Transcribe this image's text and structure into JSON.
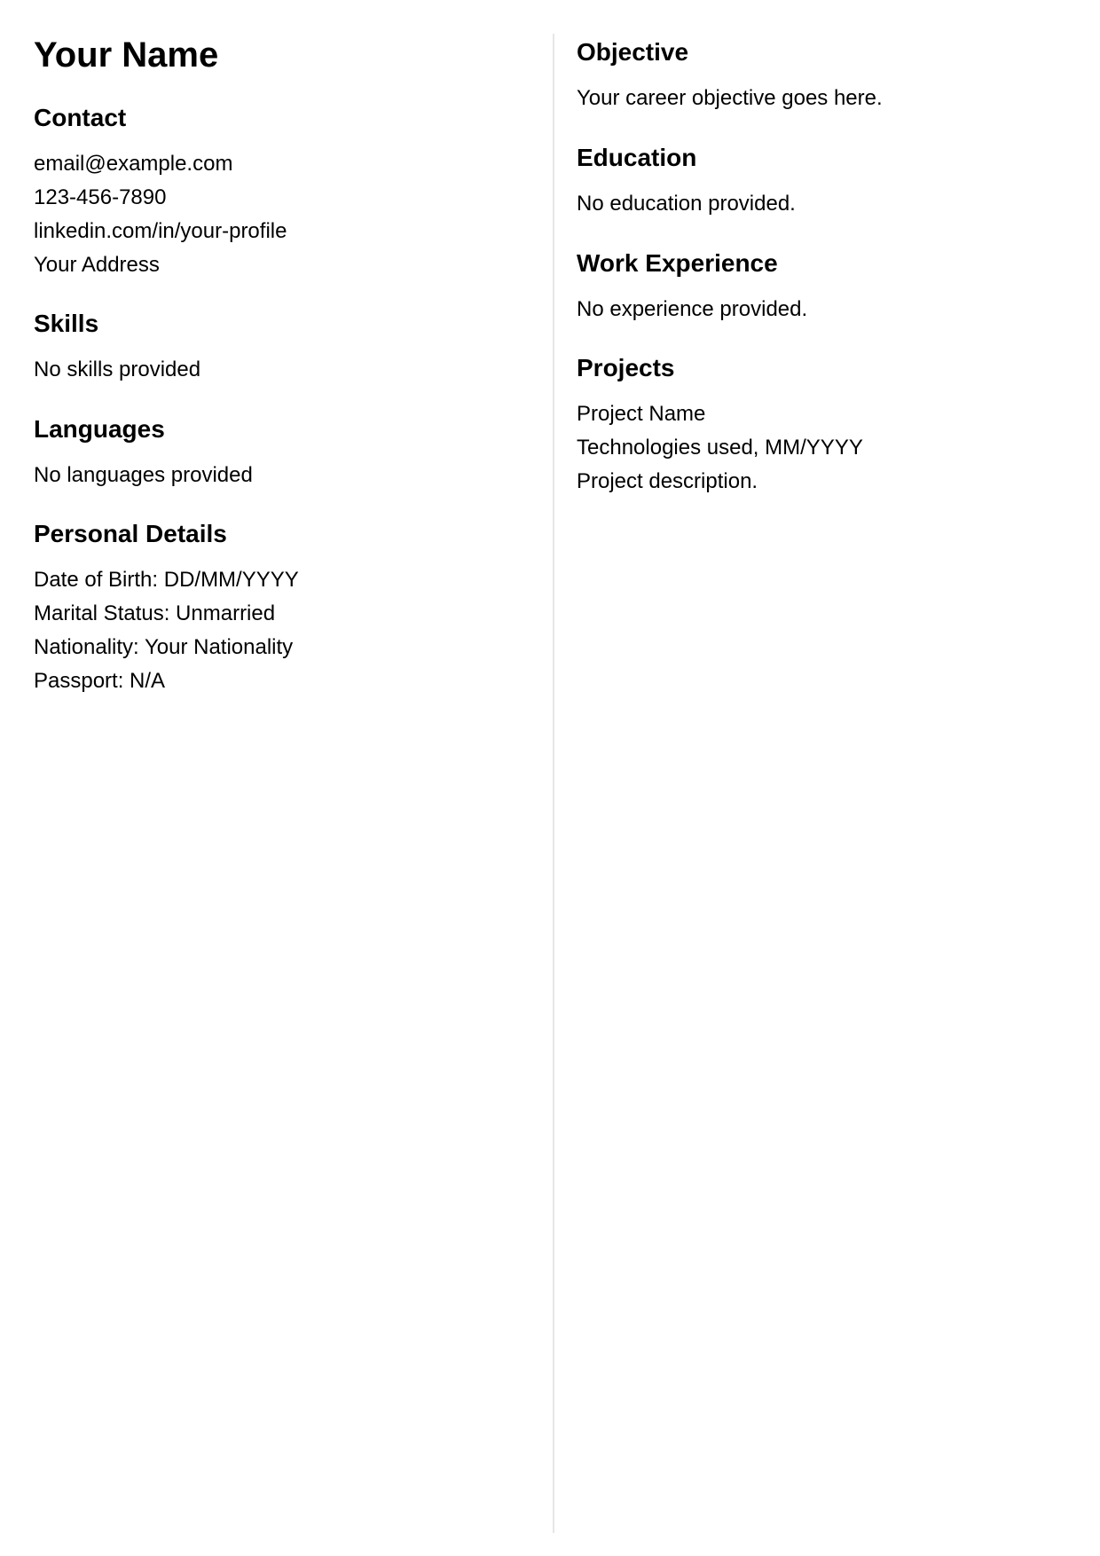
{
  "left": {
    "name": "Your Name",
    "contact": {
      "title": "Contact",
      "email": "email@example.com",
      "phone": "123-456-7890",
      "linkedin": "linkedin.com/in/your-profile",
      "address": "Your Address"
    },
    "skills": {
      "title": "Skills",
      "text": "No skills provided"
    },
    "languages": {
      "title": "Languages",
      "text": "No languages provided"
    },
    "personal": {
      "title": "Personal Details",
      "dob": "Date of Birth: DD/MM/YYYY",
      "marital": "Marital Status: Unmarried",
      "nationality": "Nationality: Your Nationality",
      "passport": "Passport: N/A"
    }
  },
  "right": {
    "objective": {
      "title": "Objective",
      "text": "Your career objective goes here."
    },
    "education": {
      "title": "Education",
      "text": "No education provided."
    },
    "experience": {
      "title": "Work Experience",
      "text": "No experience provided."
    },
    "projects": {
      "title": "Projects",
      "name": "Project Name",
      "tech": "Technologies used, MM/YYYY",
      "description": "Project description."
    }
  }
}
